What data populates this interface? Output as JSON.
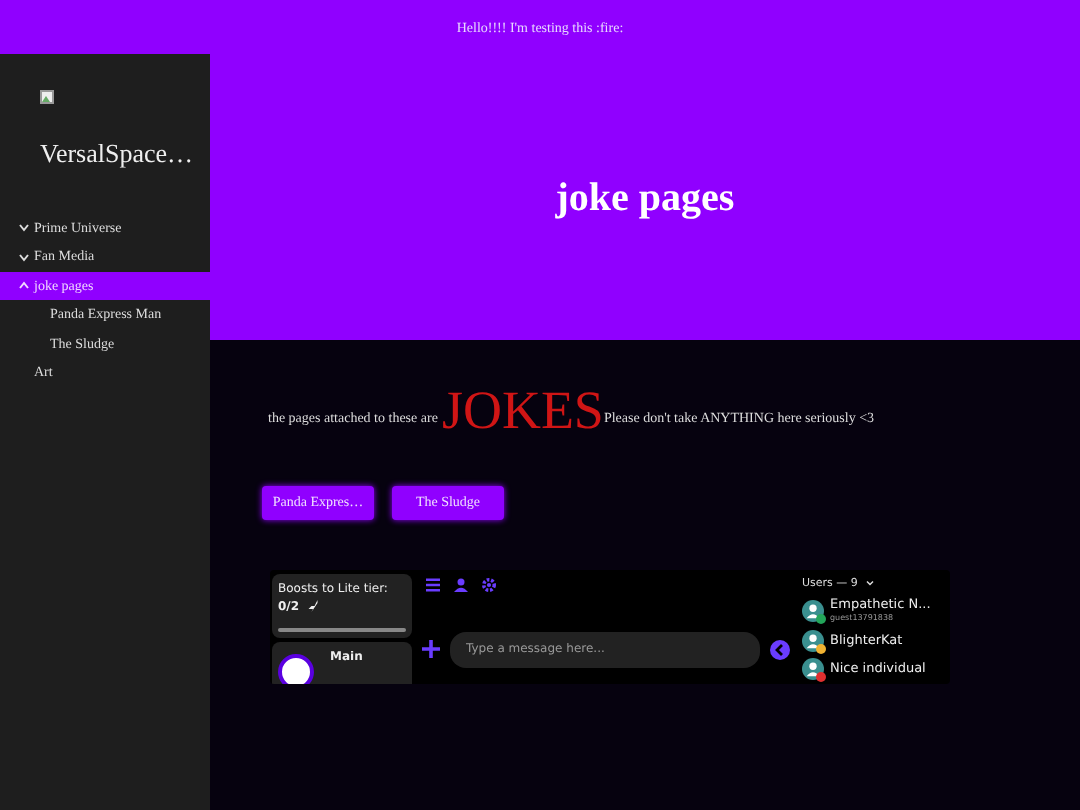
{
  "banner": {
    "text": "Hello!!!! I'm testing this :fire:"
  },
  "sidebar": {
    "title": "VersalSpace…",
    "items": [
      {
        "label": "Prime Universe",
        "expanded": false,
        "selected": false
      },
      {
        "label": "Fan Media",
        "expanded": false,
        "selected": false
      },
      {
        "label": "joke pages",
        "expanded": true,
        "selected": true,
        "children": [
          {
            "label": "Panda Express Man",
            "selected": false
          },
          {
            "label": "The Sludge",
            "selected": false
          }
        ]
      },
      {
        "label": "Art",
        "selected": false
      }
    ]
  },
  "hero": {
    "title": "joke pages"
  },
  "intro": {
    "before": "the pages attached to these are",
    "emphasis": "JOKES",
    "after": "Please don't take ANYTHING here seriously <3"
  },
  "buttons": [
    "Panda Expres…",
    "The Sludge"
  ],
  "chat_widget": {
    "boost_label": "Boosts to Lite tier:",
    "boost_count": "0/2",
    "channels": [
      {
        "name": "Main"
      }
    ],
    "composer": {
      "placeholder": "Type a message here..."
    },
    "users_header": "Users — 9",
    "users": [
      {
        "name": "Empathetic N...",
        "subtitle": "guest13791838",
        "color": "#23a55a"
      },
      {
        "name": "BlighterKat",
        "color": "#f0b232"
      },
      {
        "name": "Nice individual",
        "color": "#e03030"
      }
    ]
  }
}
